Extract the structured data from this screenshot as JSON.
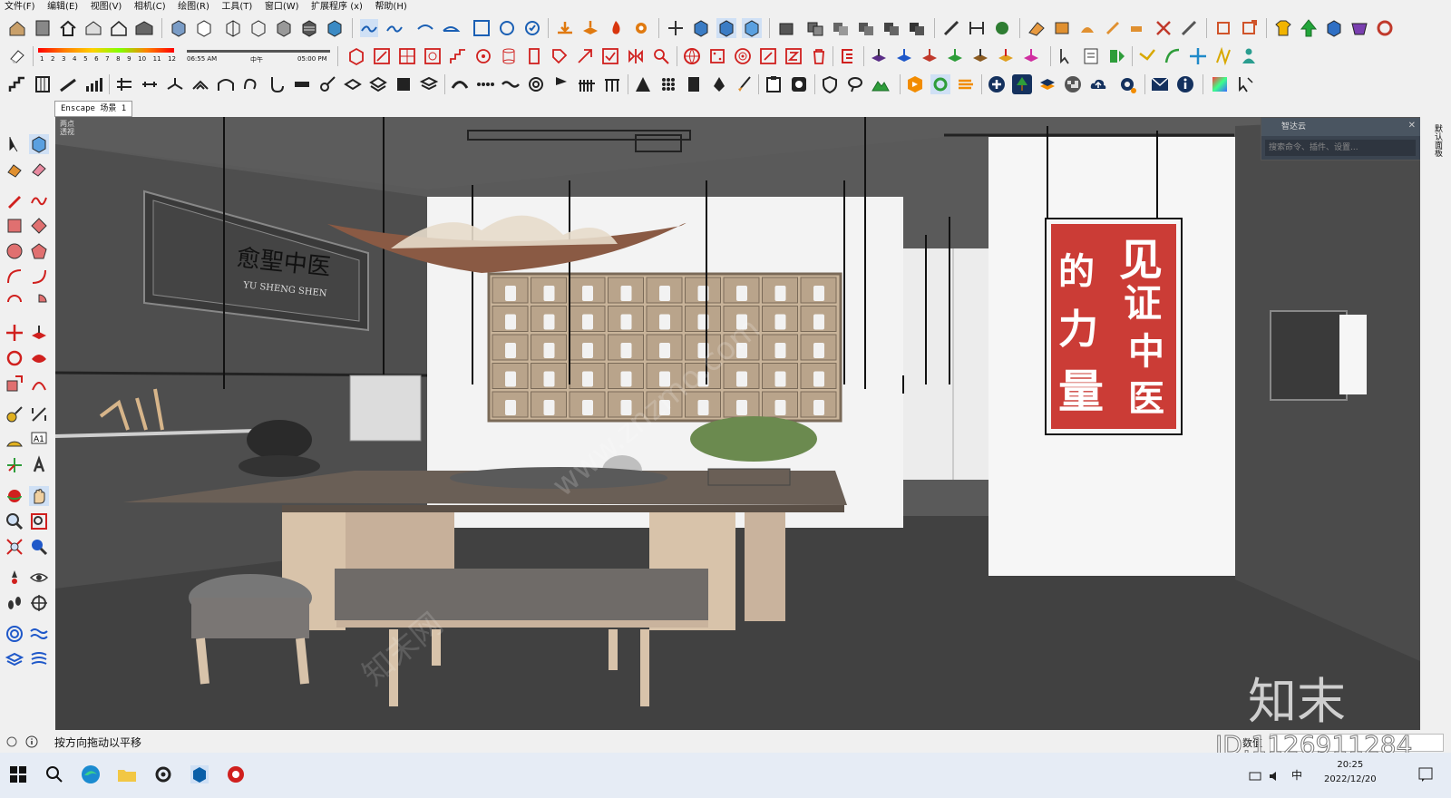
{
  "menu": [
    "文件(F)",
    "编辑(E)",
    "视图(V)",
    "相机(C)",
    "绘图(R)",
    "工具(T)",
    "窗口(W)",
    "扩展程序 (x)",
    "帮助(H)"
  ],
  "shadow_bar": {
    "months": [
      "1",
      "2",
      "3",
      "4",
      "5",
      "6",
      "7",
      "8",
      "9",
      "10",
      "11",
      "12"
    ],
    "time_start": "06:55 AM",
    "time_mid": "中午",
    "time_end": "05:00 PM"
  },
  "scene_tab": "Enscape 场景 1",
  "viewport": {
    "label_line1": "两点",
    "label_line2": "透视",
    "sign_cn": "愈聖中医",
    "sign_en": "YU SHENG SHEN",
    "poster_text": [
      "见",
      "证",
      "中",
      "医",
      "的",
      "力",
      "量"
    ],
    "watermark_brand": "知末",
    "watermark_url": "www.znzmo.com",
    "watermark_cn": "知末网"
  },
  "zhidayun": {
    "title": "智达云",
    "search_placeholder": "搜索命令、插件、设置..."
  },
  "right_panel_label": "默认面板",
  "status": {
    "message": "按方向拖动以平移",
    "measure_label": "数值",
    "id_overlay": "ID:1126911284"
  },
  "taskbar": {
    "time": "20:25",
    "date": "2022/12/20",
    "ime": "中"
  }
}
